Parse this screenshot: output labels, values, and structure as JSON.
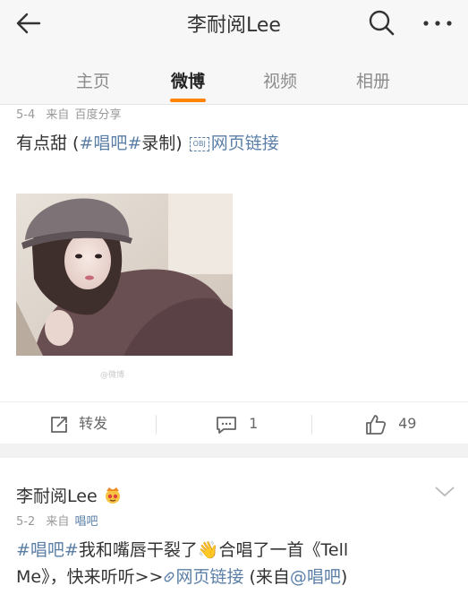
{
  "header": {
    "title": "李耐阅Lee",
    "back_icon": "back-arrow-icon",
    "search_icon": "search-icon",
    "more_icon": "more-icon"
  },
  "tabs": [
    {
      "label": "主页",
      "active": false
    },
    {
      "label": "微博",
      "active": true
    },
    {
      "label": "视频",
      "active": false
    },
    {
      "label": "相册",
      "active": false
    }
  ],
  "accent_color": "#ff8200",
  "link_color": "#5b7fa7",
  "post1": {
    "date": "5-4",
    "source_prefix": "来自",
    "source": "百度分享",
    "text_prefix": "有点甜 (",
    "tag": "#唱吧#",
    "text_mid": "录制) ",
    "obj_label": "OBJ",
    "link_text": "网页链接",
    "watermark": "@微博",
    "repost_label": "转发",
    "comment_count": "1",
    "like_count": "49"
  },
  "post2": {
    "username": "李耐阅Lee",
    "badge": "crown-emoji",
    "date": "5-2",
    "source_prefix": "来自",
    "source": "唱吧",
    "tag": "#唱吧#",
    "text_1": "我和嘴唇干裂了",
    "emoji": "👋",
    "text_2": "合唱了一首《Tell",
    "text_3": "Me》，快来听听>>",
    "link_text": "网页链接",
    "text_4": " (来自",
    "mention": "@唱吧",
    "text_5": ")"
  }
}
